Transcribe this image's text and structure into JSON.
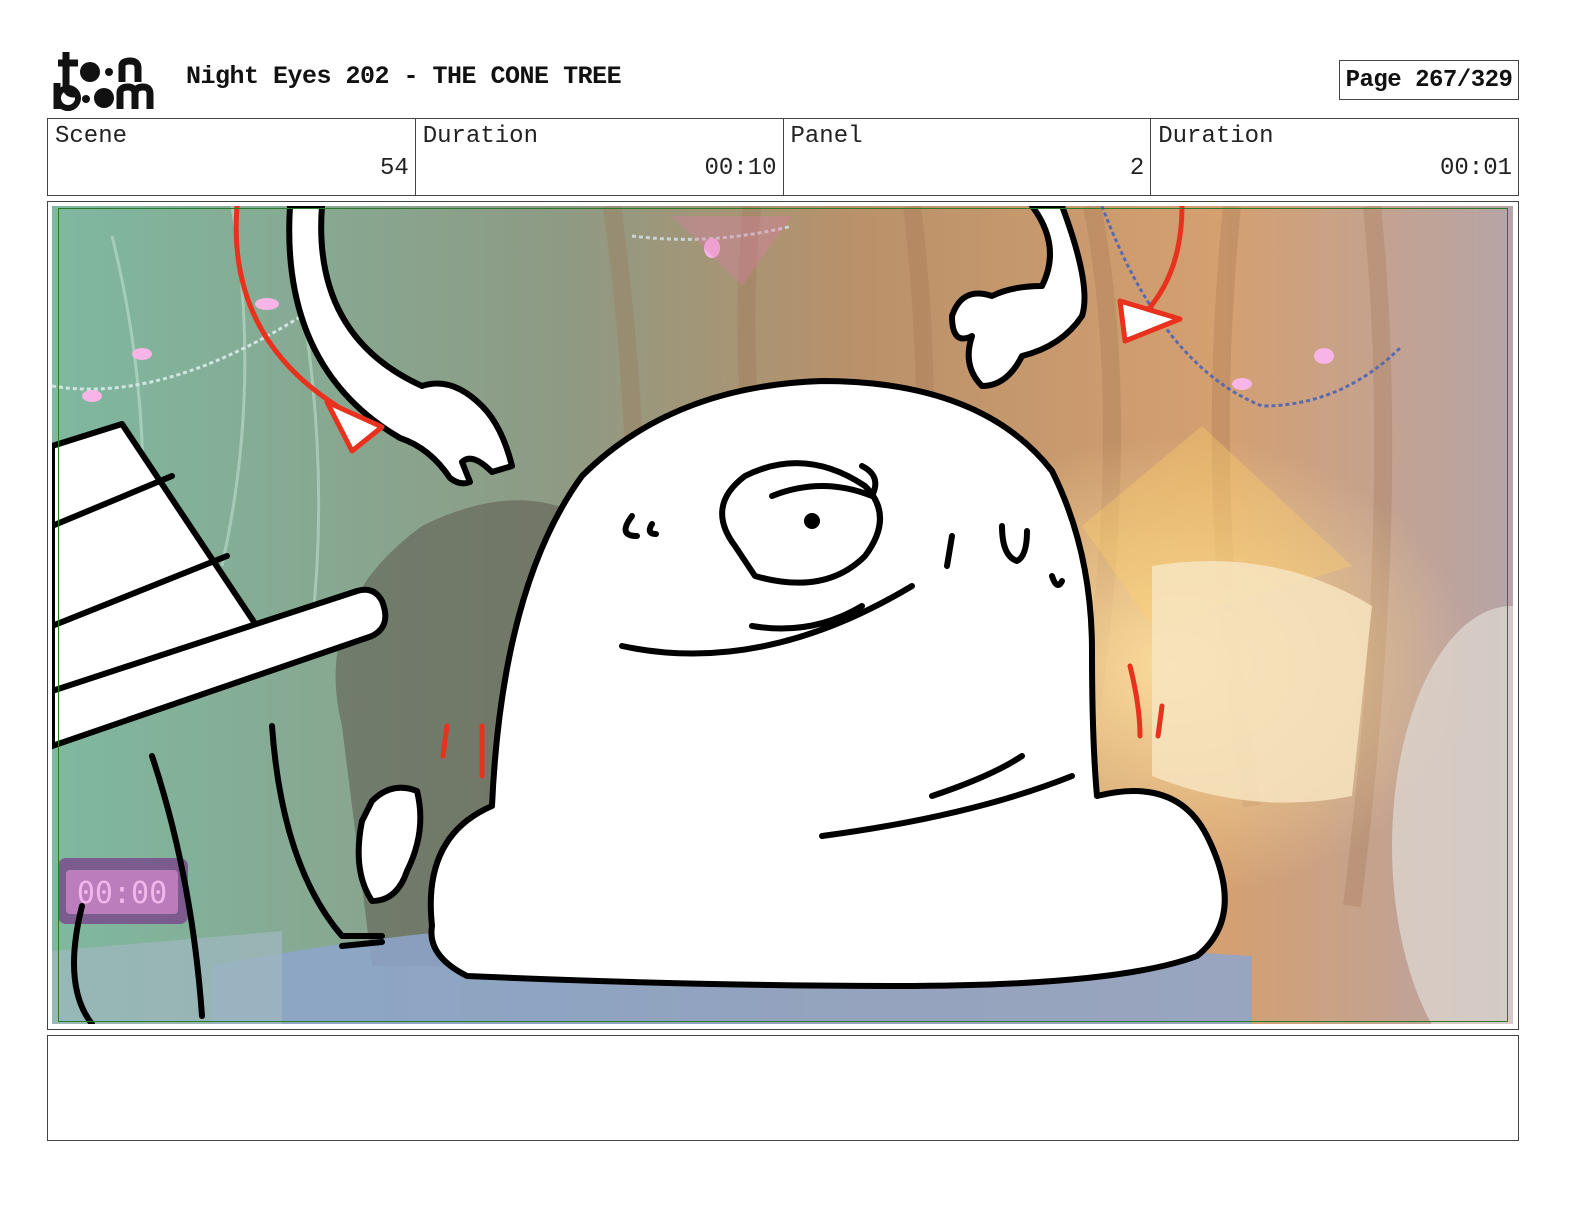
{
  "header": {
    "logo_text_top": "toon",
    "logo_text_bottom": "boom",
    "title": "Night Eyes 202 - THE CONE TREE",
    "page": "Page 267/329"
  },
  "info": {
    "scene_label": "Scene",
    "scene_value": "54",
    "scene_duration_label": "Duration",
    "scene_duration_value": "00:10",
    "panel_label": "Panel",
    "panel_value": "2",
    "panel_duration_label": "Duration",
    "panel_duration_value": "00:01"
  },
  "panel": {
    "clock_readout": "00:00",
    "accent_colors": {
      "arrow_red": "#e8321e",
      "frame_green": "#2c7a2c"
    }
  },
  "caption": {
    "text": ""
  }
}
